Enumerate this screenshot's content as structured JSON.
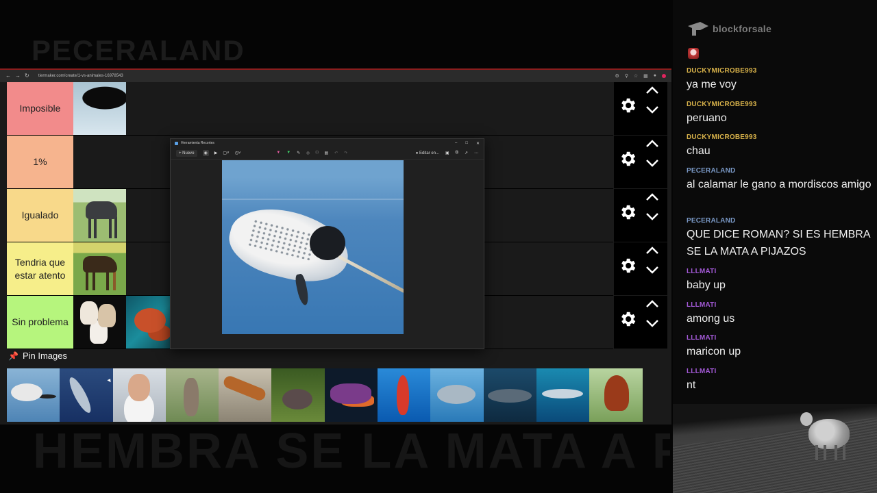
{
  "overlay": {
    "channel_title": "PECERALAND",
    "caption_text": "HEMBRA SE LA MATA A P"
  },
  "browser": {
    "url": "tiermaker.com/create/1-vs-animales-16978543"
  },
  "tiers": [
    {
      "label": "Imposible",
      "color": "#f28b8b",
      "items": [
        "orca"
      ]
    },
    {
      "label": "1%",
      "color": "#f6b48e",
      "items": []
    },
    {
      "label": "Igualado",
      "color": "#f8d98a",
      "items": [
        "great-dane"
      ]
    },
    {
      "label": "Tendria que estar atento",
      "color": "#f6ee8a",
      "items": [
        "doberman"
      ]
    },
    {
      "label": "Sin problema",
      "color": "#b6f57d",
      "items": [
        "chihuahuas",
        "octopus"
      ]
    }
  ],
  "snipping_tool": {
    "title": "Herramienta Recortes",
    "new_label": "Nuevo",
    "edit_label": "Editar en...",
    "image_subject": "narwhal"
  },
  "pin_images": {
    "heading": "Pin Images",
    "items": [
      "narwhal",
      "swordfish",
      "man",
      "kangaroo",
      "centipede",
      "hippo",
      "octopus",
      "seahorse",
      "dolphin",
      "whale",
      "shark",
      "rooster"
    ]
  },
  "chat": {
    "brand": "blockforsale",
    "messages": [
      {
        "user": "DUCKYMICROBE993",
        "text": "ya me voy",
        "color": "#d8b24a"
      },
      {
        "user": "DUCKYMICROBE993",
        "text": "peruano",
        "color": "#d8b24a"
      },
      {
        "user": "DUCKYMICROBE993",
        "text": "chau",
        "color": "#d8b24a"
      },
      {
        "user": "PECERALAND",
        "text": "al calamar le gano a mordiscos amigo",
        "color": "#7b9ac8"
      },
      {
        "user": "PECERALAND",
        "text": "QUE DICE ROMAN? SI ES HEMBRA SE LA MATA A PIJAZOS",
        "color": "#7b9ac8"
      },
      {
        "user": "LLLMATI",
        "text": "baby up",
        "color": "#a45ad8"
      },
      {
        "user": "LLLMATI",
        "text": "among us",
        "color": "#a45ad8"
      },
      {
        "user": "LLLMATI",
        "text": "maricon up",
        "color": "#a45ad8"
      },
      {
        "user": "LLLMATI",
        "text": "nt",
        "color": "#a45ad8"
      }
    ]
  },
  "icons": {
    "gear": "gear-icon",
    "up": "chevron-up-icon",
    "down": "chevron-down-icon",
    "pin": "pin-icon"
  }
}
